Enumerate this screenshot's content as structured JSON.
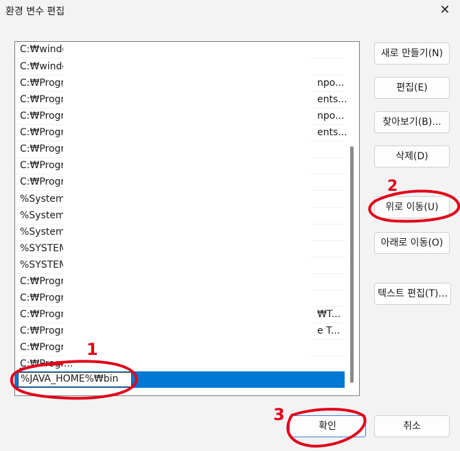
{
  "window": {
    "title": "환경 변수 편집",
    "close_glyph": "✕"
  },
  "list": {
    "items": [
      {
        "pre": "C:₩windo",
        "suf": ""
      },
      {
        "pre": "C:₩windo",
        "suf": ""
      },
      {
        "pre": "C:₩Progr",
        "suf": "npo..."
      },
      {
        "pre": "C:₩Progr",
        "suf": "ents..."
      },
      {
        "pre": "C:₩Progr",
        "suf": "npo..."
      },
      {
        "pre": "C:₩Progr",
        "suf": "ents..."
      },
      {
        "pre": "C:₩Progr",
        "suf": ""
      },
      {
        "pre": "C:₩Progr",
        "suf": ""
      },
      {
        "pre": "C:₩Progr",
        "suf": ""
      },
      {
        "pre": "%System",
        "suf": ""
      },
      {
        "pre": "%System",
        "suf": ""
      },
      {
        "pre": "%System",
        "suf": ""
      },
      {
        "pre": "%SYSTEM",
        "suf": ""
      },
      {
        "pre": "%SYSTEM",
        "suf": ""
      },
      {
        "pre": "C:₩Progr",
        "suf": ""
      },
      {
        "pre": "C:₩Progr",
        "suf": ""
      },
      {
        "pre": "C:₩Progr",
        "suf": "₩T..."
      },
      {
        "pre": "C:₩Progr",
        "suf": "e T..."
      },
      {
        "pre": "C:₩Progr",
        "suf": ""
      },
      {
        "pre": "C:₩Progr...",
        "suf": ""
      }
    ],
    "edit_value": "%JAVA_HOME%₩bin"
  },
  "buttons": {
    "new": "새로 만들기(N)",
    "edit": "편집(E)",
    "browse": "찾아보기(B)...",
    "delete": "삭제(D)",
    "move_up": "위로 이동(U)",
    "move_down": "아래로 이동(O)",
    "edit_text": "텍스트 편집(T)...",
    "ok": "확인",
    "cancel": "취소"
  },
  "annotations": {
    "step1": "1",
    "step2": "2",
    "step3": "3",
    "color": "#e0001a"
  }
}
